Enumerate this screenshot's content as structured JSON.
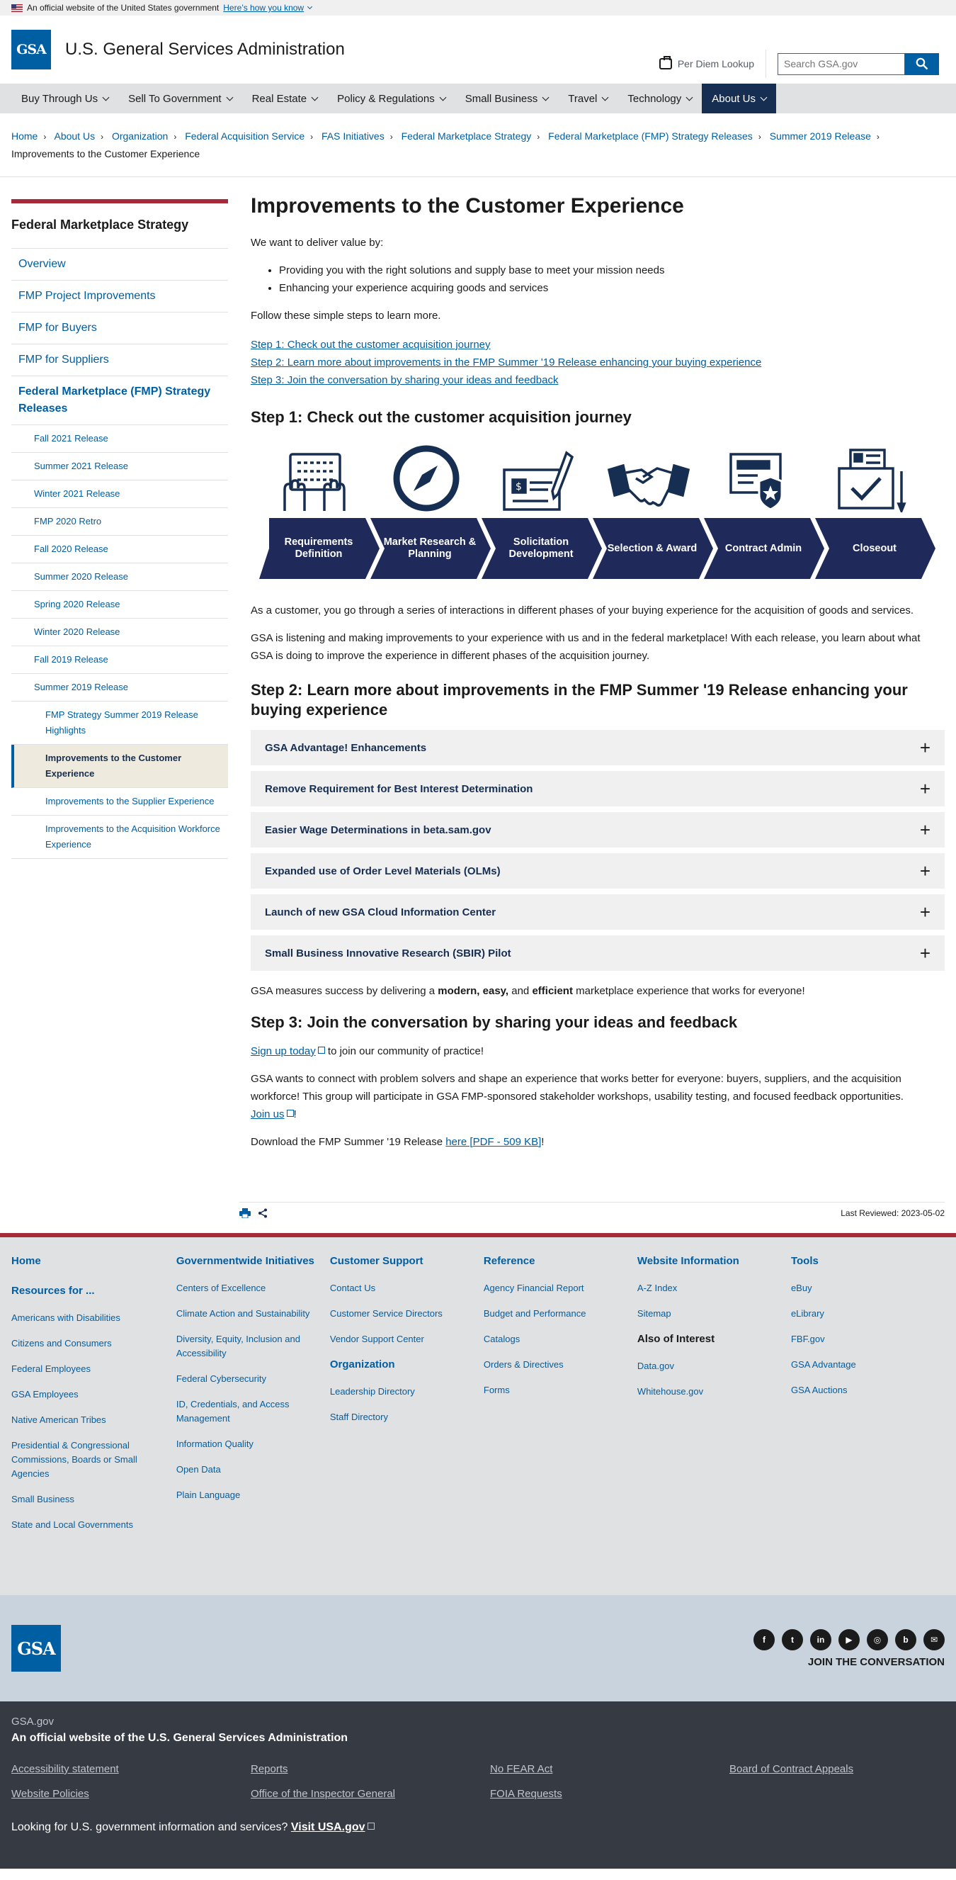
{
  "banner": {
    "text": "An official website of the United States government",
    "link": "Here’s how you know"
  },
  "header": {
    "logo": "GSA",
    "site_name": "U.S. General Services Administration",
    "perdiem": "Per Diem Lookup",
    "search_placeholder": "Search GSA.gov"
  },
  "nav": [
    "Buy Through Us",
    "Sell To Government",
    "Real Estate",
    "Policy & Regulations",
    "Small Business",
    "Travel",
    "Technology",
    "About Us"
  ],
  "breadcrumb": [
    "Home",
    "About Us",
    "Organization",
    "Federal Acquisition Service",
    "FAS Initiatives",
    "Federal Marketplace Strategy",
    "Federal Marketplace (FMP) Strategy Releases",
    "Summer 2019 Release",
    "Improvements to the Customer Experience"
  ],
  "sidebar": {
    "title": "Federal Marketplace Strategy",
    "items": [
      "Overview",
      "FMP Project Improvements",
      "FMP for Buyers",
      "FMP for Suppliers",
      "Federal Marketplace (FMP) Strategy Releases"
    ],
    "releases": [
      "Fall 2021 Release",
      "Summer 2021 Release",
      "Winter 2021 Release",
      "FMP 2020 Retro",
      "Fall 2020 Release",
      "Summer 2020 Release",
      "Spring 2020 Release",
      "Winter 2020 Release",
      "Fall 2019 Release",
      "Summer 2019 Release"
    ],
    "summer_items": [
      "FMP Strategy Summer 2019 Release Highlights",
      "Improvements to the Customer Experience",
      "Improvements to the Supplier Experience",
      "Improvements to the Acquisition Workforce Experience"
    ]
  },
  "main": {
    "title": "Improvements to the Customer Experience",
    "intro": "We want to deliver value by:",
    "bullets": [
      "Providing you with the right solutions and supply base to meet your mission needs",
      "Enhancing your experience acquiring goods and services"
    ],
    "follow": "Follow these simple steps to learn more.",
    "step_links": [
      "Step 1: Check out the customer acquisition journey",
      "Step 2: Learn more about improvements in the FMP Summer '19 Release enhancing your buying experience",
      "Step 3: Join the conversation by sharing your ideas and feedback"
    ],
    "step1_heading": "Step 1: Check out the customer acquisition journey",
    "journey": [
      "Requirements Definition",
      "Market Research & Planning",
      "Solicitation Development",
      "Selection & Award",
      "Contract Admin",
      "Closeout"
    ],
    "p1": "As a customer, you go through a series of interactions in different phases of your buying experience for the acquisition of goods and services.",
    "p2": "GSA is listening and making improvements to your experience with us and in the federal marketplace! With each release, you learn about what GSA is doing to improve the experience in different phases of the acquisition journey.",
    "step2_heading": "Step 2: Learn more about improvements in the FMP Summer '19 Release enhancing your buying experience",
    "accordions": [
      "GSA Advantage! Enhancements",
      "Remove Requirement for Best Interest Determination",
      "Easier Wage Determinations in beta.sam.gov",
      "Expanded use of Order Level Materials (OLMs)",
      "Launch of new GSA Cloud Information Center",
      "Small Business Innovative Research (SBIR) Pilot"
    ],
    "measures_pre": "GSA measures success by delivering a ",
    "measures_b1": "modern, easy,",
    "measures_mid": " and ",
    "measures_b2": "efficient",
    "measures_post": " marketplace experience that works for everyone!",
    "step3_heading": "Step 3: Join the conversation by sharing your ideas and feedback",
    "signup_link": "Sign up today",
    "signup_rest": " to join our community of practice!",
    "connect": "GSA wants to connect with problem solvers and shape an experience that works better for everyone: buyers, suppliers, and the acquisition workforce! This group will participate in GSA FMP-sponsored stakeholder workshops, usability testing, and focused feedback opportunities.",
    "join_link": "Join us",
    "download_pre": "Download the FMP Summer '19 Release ",
    "download_link": "here [PDF - 509 KB]",
    "download_post": "!",
    "last_reviewed": "Last Reviewed: 2023-05-02"
  },
  "footer": {
    "col1": {
      "home": "Home",
      "resources": "Resources for ...",
      "links": [
        "Americans with Disabilities",
        "Citizens and Consumers",
        "Federal Employees",
        "GSA Employees",
        "Native American Tribes",
        "Presidential & Congressional Commissions, Boards or Small Agencies",
        "Small Business",
        "State and Local Governments"
      ]
    },
    "col2": {
      "title": "Governmentwide Initiatives",
      "links": [
        "Centers of Excellence",
        "Climate Action and Sustainability",
        "Diversity, Equity, Inclusion and Accessibility",
        "Federal Cybersecurity",
        "ID, Credentials, and Access Management",
        "Information Quality",
        "Open Data",
        "Plain Language"
      ]
    },
    "col3": {
      "title": "Customer Support",
      "links": [
        "Contact Us",
        "Customer Service Directors",
        "Vendor Support Center"
      ],
      "title2": "Organization",
      "links2": [
        "Leadership Directory",
        "Staff Directory"
      ]
    },
    "col4": {
      "title": "Reference",
      "links": [
        "Agency Financial Report",
        "Budget and Performance",
        "Catalogs",
        "Orders & Directives",
        "Forms"
      ]
    },
    "col5": {
      "title": "Website Information",
      "links": [
        "A-Z Index",
        "Sitemap"
      ],
      "title2": "Also of Interest",
      "links2": [
        "Data.gov",
        "Whitehouse.gov"
      ]
    },
    "col6": {
      "title": "Tools",
      "links": [
        "eBuy",
        "eLibrary",
        "FBF.gov",
        "GSA Advantage",
        "GSA Auctions"
      ]
    },
    "join": "JOIN THE CONVERSATION",
    "social": [
      "f",
      "t",
      "in",
      "▶",
      "◎",
      "b",
      "✉"
    ],
    "domain": "GSA.gov",
    "official": "An official website of the U.S. General Services Administration",
    "id_links": [
      "Accessibility statement",
      "Reports",
      "No FEAR Act",
      "Board of Contract Appeals",
      "Website Policies",
      "Office of the Inspector General",
      "FOIA Requests"
    ],
    "usa_pre": "Looking for U.S. government information and services? ",
    "usa_link": "Visit USA.gov"
  }
}
